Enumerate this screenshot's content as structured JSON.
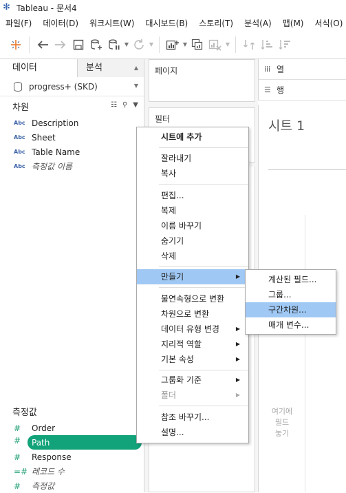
{
  "window": {
    "title": "Tableau - 문서4"
  },
  "menubar": [
    "파일(F)",
    "데이터(D)",
    "워크시트(W)",
    "대시보드(B)",
    "스토리(T)",
    "분석(A)",
    "맵(M)",
    "서식(O)"
  ],
  "left_pane": {
    "tabs": {
      "data": "데이터",
      "analysis": "분석"
    },
    "datasource": "progress+ (SKD)",
    "dimensions_header": "차원",
    "dimensions": [
      {
        "type": "Abc",
        "name": "Description"
      },
      {
        "type": "Abc",
        "name": "Sheet"
      },
      {
        "type": "Abc",
        "name": "Table Name"
      },
      {
        "type": "Abc",
        "name": "측정값 이름"
      }
    ],
    "measures_header": "측정값",
    "measures": [
      {
        "type": "#",
        "name": "Order"
      },
      {
        "type": "#",
        "name": "Path"
      },
      {
        "type": "#",
        "name": "Response"
      },
      {
        "type": "=#",
        "name": "레코드 수"
      },
      {
        "type": "#",
        "name": "측정값"
      }
    ]
  },
  "cards": {
    "pages": "페이지",
    "filters": "필터"
  },
  "shelves": {
    "columns": "열",
    "rows": "행"
  },
  "canvas": {
    "sheet_title": "시트 1",
    "drop_hint_1": "여기에",
    "drop_hint_2": "필드",
    "drop_hint_3": "놓기"
  },
  "context_menu": {
    "add_to_sheet": "시트에 추가",
    "cut": "잘라내기",
    "copy": "복사",
    "edit": "편집...",
    "duplicate": "복제",
    "rename": "이름 바꾸기",
    "hide": "숨기기",
    "delete": "삭제",
    "create": "만들기",
    "to_discrete": "불연속형으로 변환",
    "to_dimension": "차원으로 변환",
    "change_type": "데이터 유형 변경",
    "geo_role": "지리적 역할",
    "default_props": "기본 속성",
    "group_by": "그룹화 기준",
    "folder": "폴더",
    "replace_refs": "참조 바꾸기...",
    "describe": "설명..."
  },
  "submenu": {
    "calc_field": "계산된 필드...",
    "group": "그룹...",
    "bins": "구간차원...",
    "parameter": "매개 변수..."
  },
  "colors": {
    "accent": "#12a37a",
    "highlight": "#9fc8f4"
  }
}
